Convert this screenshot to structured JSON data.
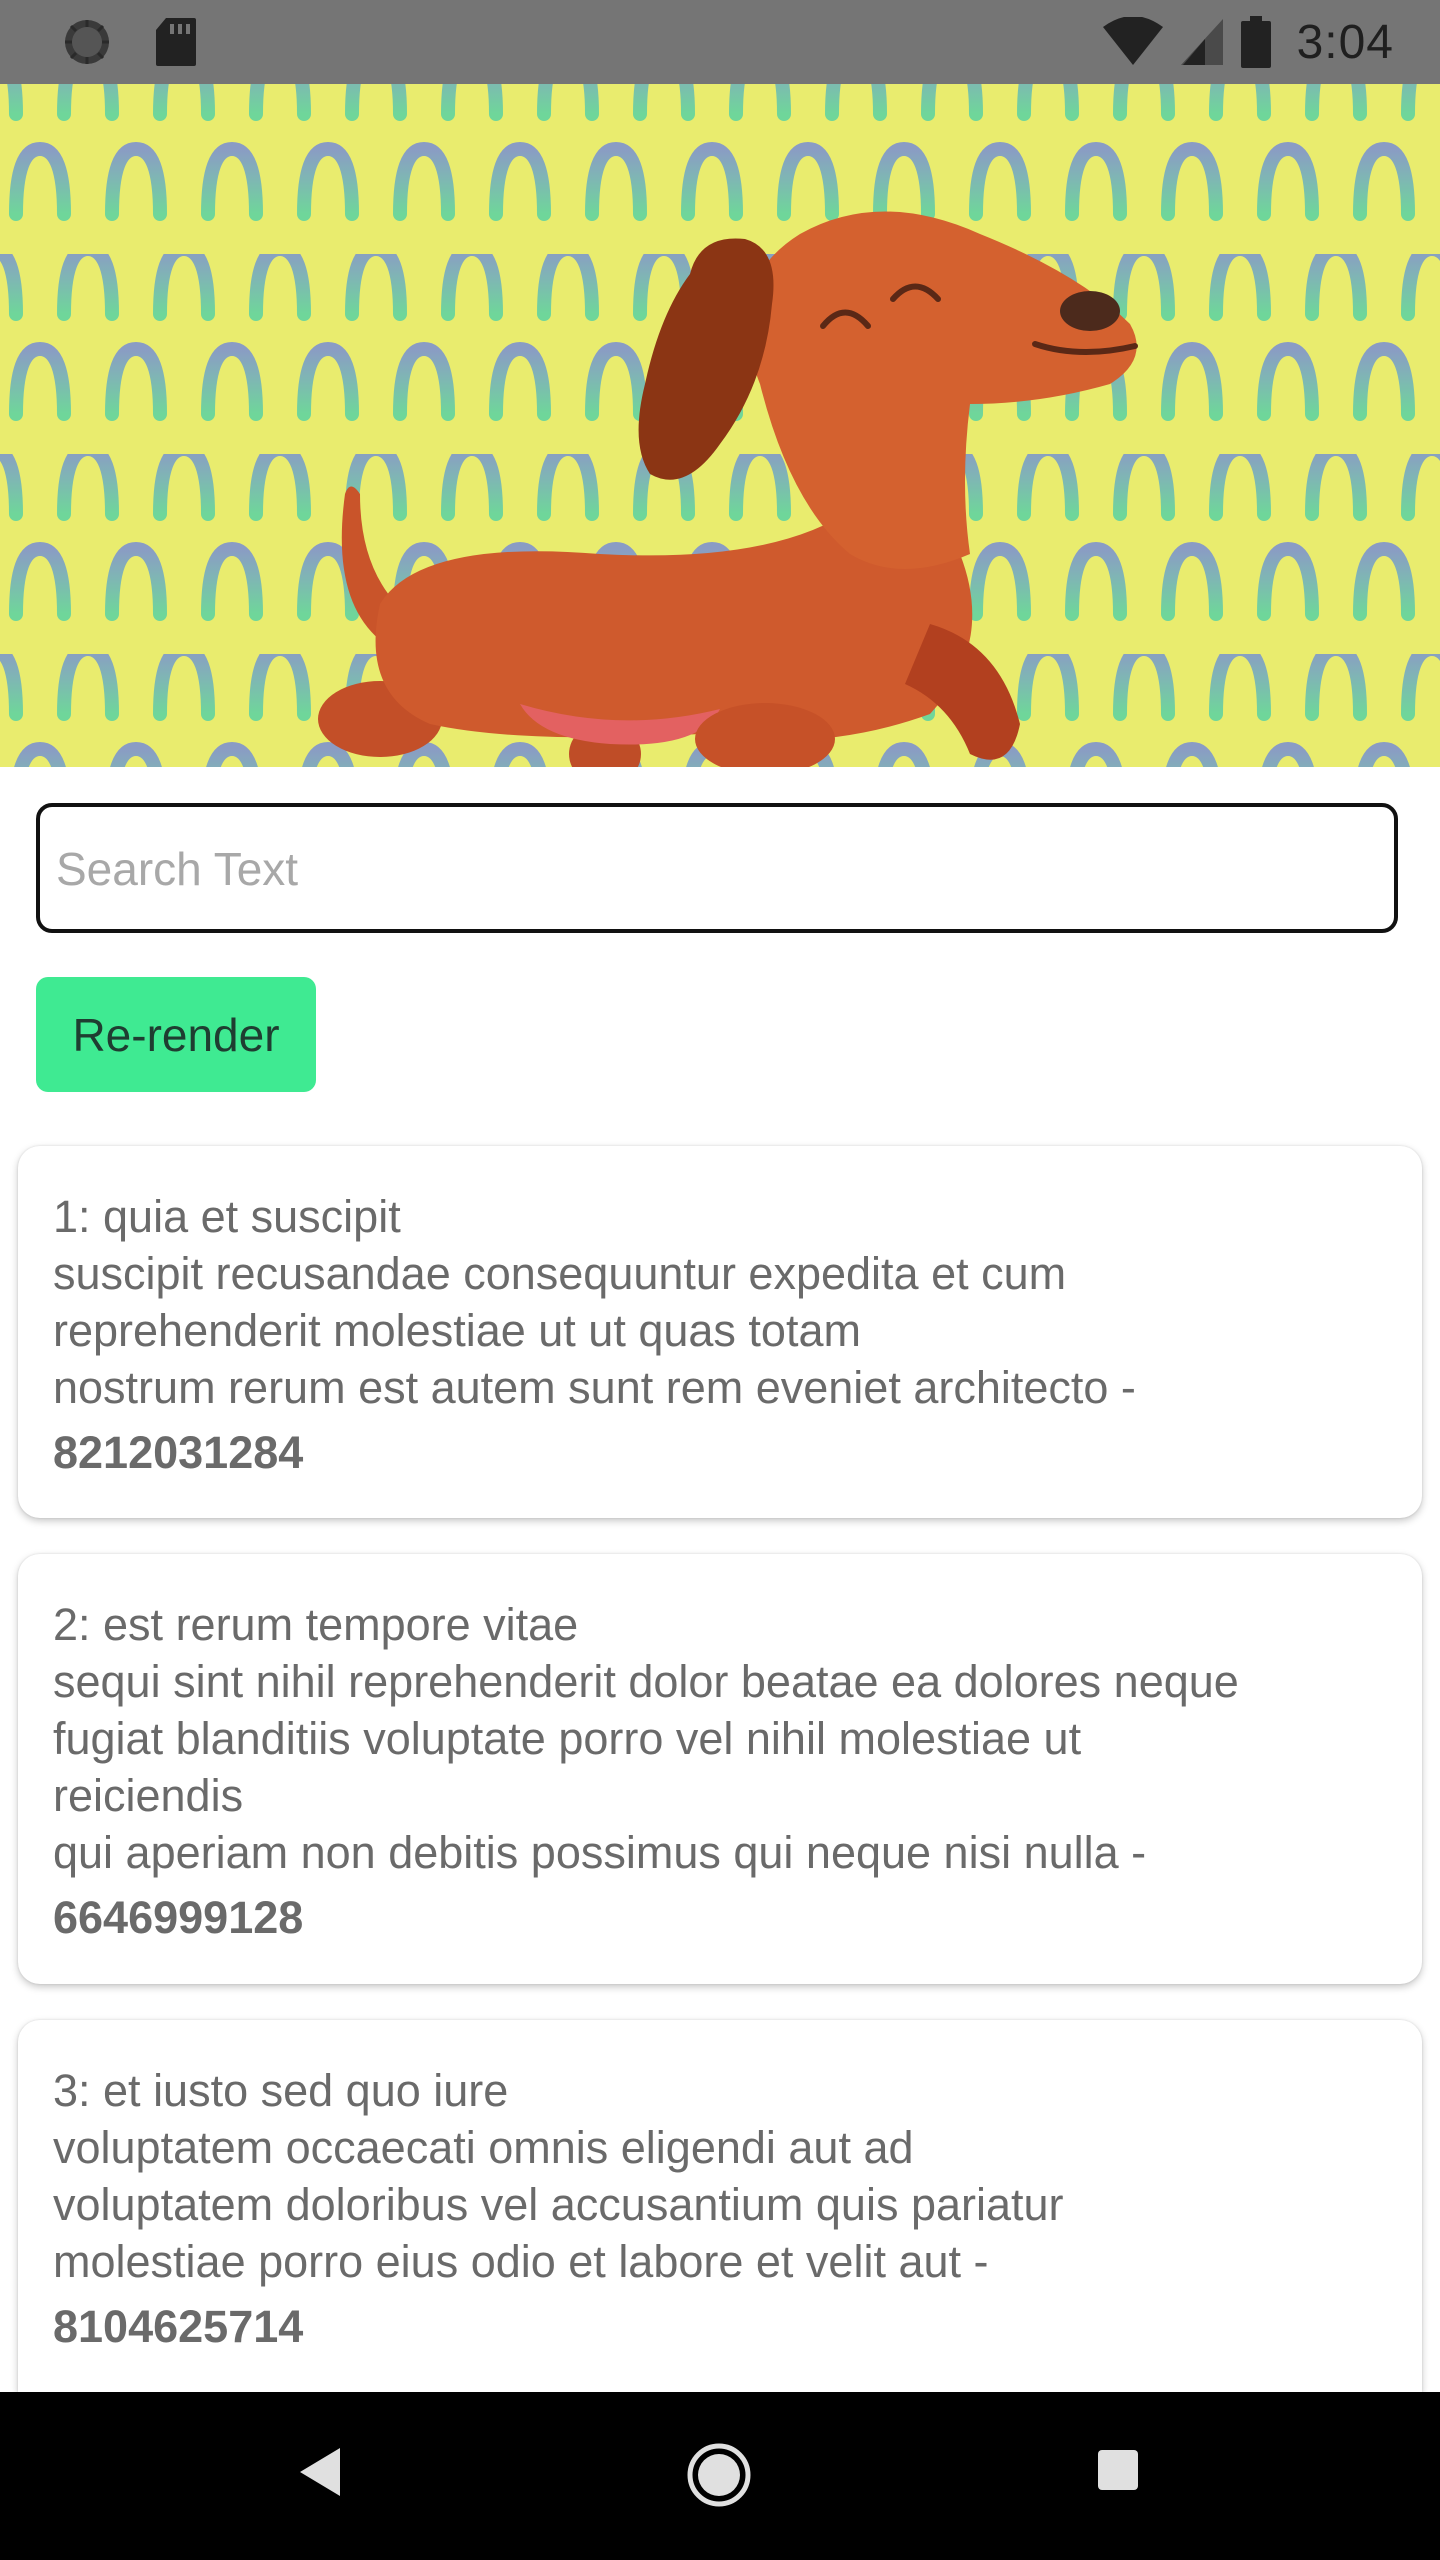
{
  "status_bar": {
    "time": "3:04",
    "icons": [
      "sync-icon",
      "sd-card-icon",
      "wifi-icon",
      "signal-icon",
      "battery-icon"
    ]
  },
  "search": {
    "placeholder": "Search Text",
    "value": ""
  },
  "rerender_button": {
    "label": "Re-render",
    "color": "#3fea92"
  },
  "posts": [
    {
      "title": "1: quia et suscipit",
      "body_lines": [
        "suscipit recusandae consequuntur expedita et cum",
        "reprehenderit molestiae ut ut quas totam",
        "nostrum rerum est autem sunt rem eveniet architecto -"
      ],
      "phone": "8212031284"
    },
    {
      "title": "2: est rerum tempore vitae",
      "body_lines": [
        "sequi sint nihil reprehenderit dolor beatae ea dolores neque",
        "fugiat blanditiis voluptate porro vel nihil molestiae ut",
        "reiciendis",
        "qui aperiam non debitis possimus qui neque nisi nulla -"
      ],
      "phone": "6646999128"
    },
    {
      "title": "3: et iusto sed quo iure",
      "body_lines": [
        "voluptatem occaecati omnis eligendi aut ad",
        "voluptatem doloribus vel accusantium quis pariatur",
        "molestiae porro eius odio et labore et velit aut -"
      ],
      "phone": "8104625714"
    }
  ],
  "nav_bar": {
    "buttons": [
      "back-icon",
      "home-icon",
      "recents-icon"
    ]
  }
}
